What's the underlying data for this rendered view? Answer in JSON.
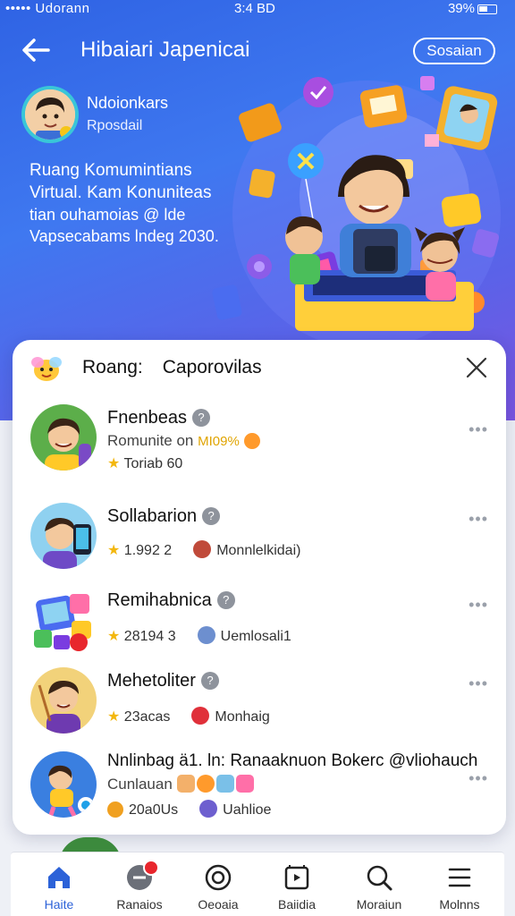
{
  "status_bar": {
    "left": "••••• Udorann",
    "center": "3:4 BD",
    "right": "39%"
  },
  "header": {
    "title": "Hibaiari Japenicai",
    "action_label": "Sosaian"
  },
  "profile": {
    "name": "Ndoionkars",
    "role": "Rposdail"
  },
  "hero_text": [
    "Ruang Komumintians",
    "Virtual. Kam Konuniteas",
    "tian ouhamoias @ lde",
    "Vapsecabams lndeg 2030."
  ],
  "sheet": {
    "title_left": "Roang:",
    "title_right": "Caporovilas",
    "items": [
      {
        "name": "Fnenbeas",
        "sub": "Romunite on",
        "sub_highlight": "MI09%",
        "meta": "Toriab 60"
      },
      {
        "name": "Sollabarion",
        "meta": "1.992 2",
        "meta2": "Monnlelkidai)"
      },
      {
        "name": "Remihabnica",
        "meta": "28194 3",
        "meta2": "Uemlosali1"
      },
      {
        "name": "Mehetoliter",
        "meta": "23acas",
        "meta2": "Monhaig"
      },
      {
        "name": "Nnlinbag ä1. ln: Ranaaknuon Bokerc @vliohauch",
        "sub": "Cunlauan",
        "meta": "20a0Us",
        "meta2": "Uahlioe"
      }
    ]
  },
  "tabs": [
    {
      "label": "Haite"
    },
    {
      "label": "Ranaios"
    },
    {
      "label": "Oeoaia"
    },
    {
      "label": "Baiidia"
    },
    {
      "label": "Moraiun"
    },
    {
      "label": "Molnns"
    }
  ],
  "colors": {
    "accent": "#2c62d8",
    "hero_top": "#2f63e4",
    "hero_bottom": "#7a55e0",
    "badge": "#e8262d"
  }
}
